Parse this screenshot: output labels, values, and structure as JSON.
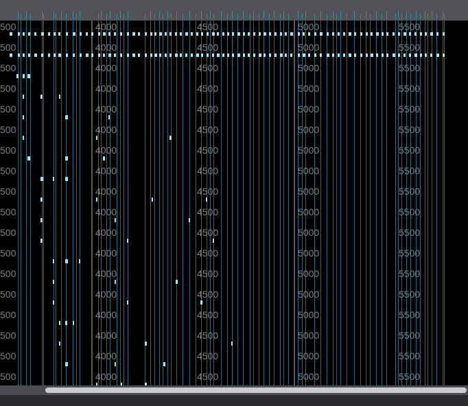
{
  "ruler": {
    "labels": [
      "500",
      "4000",
      "4500",
      "5000",
      "5500"
    ]
  },
  "scrollbar": {
    "position_fraction": 0.1,
    "visible_fraction": 0.9
  },
  "colors": {
    "background": "#000000",
    "header": "#505256",
    "grid_teal": "#1f6f80",
    "grid_grey": "#5a5d62",
    "label": "#7d8086",
    "note": "#a6e4ee",
    "scroll_thumb": "#c9cbcf"
  }
}
